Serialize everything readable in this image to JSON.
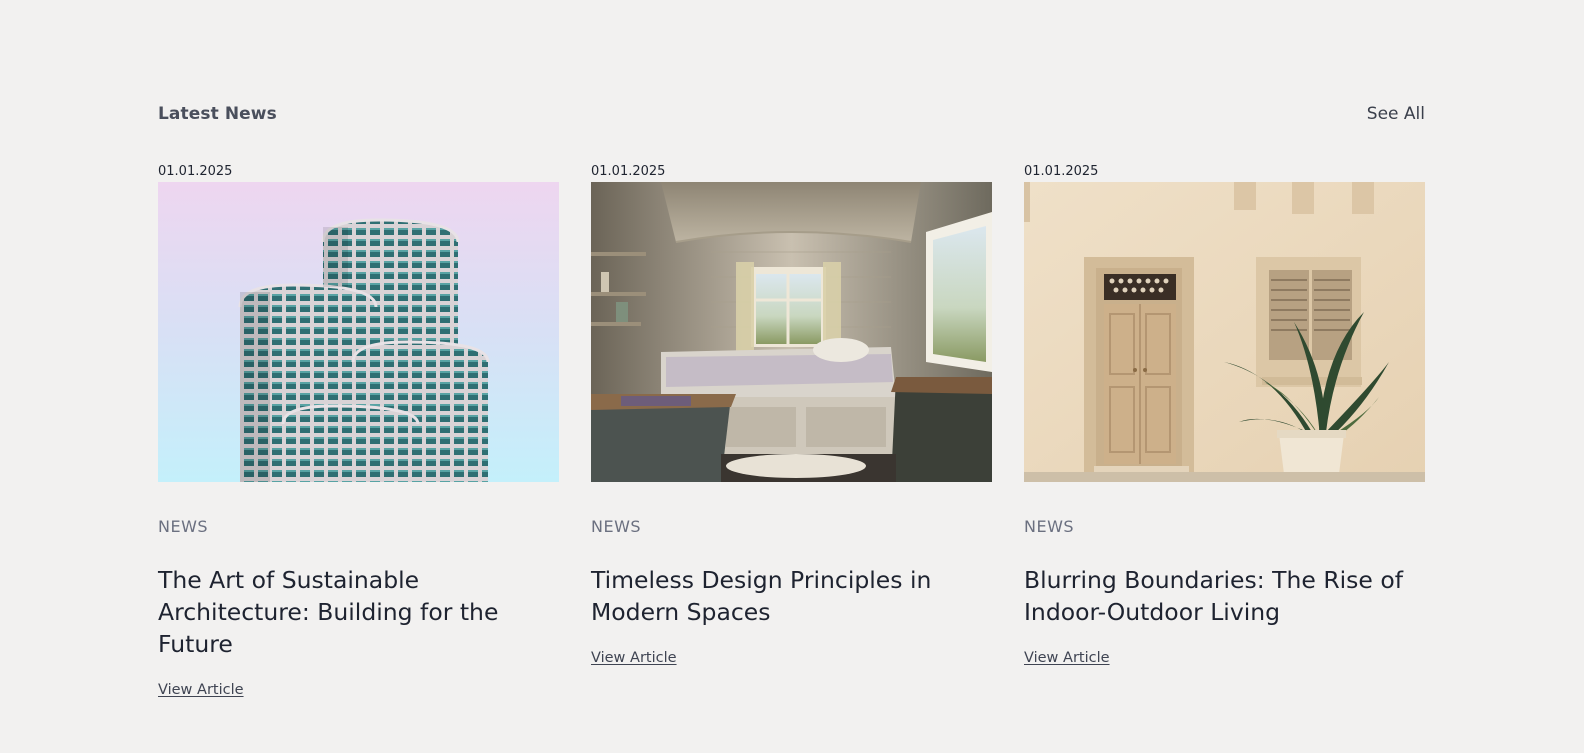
{
  "section": {
    "title": "Latest News",
    "see_all_label": "See All"
  },
  "articles": [
    {
      "date": "01.01.2025",
      "category": "NEWS",
      "title": "The Art of Sustainable Architecture: Building for the Future",
      "link_label": "View Article"
    },
    {
      "date": "01.01.2025",
      "category": "NEWS",
      "title": "Timeless Design Principles in Modern Spaces",
      "link_label": "View Article"
    },
    {
      "date": "01.01.2025",
      "category": "NEWS",
      "title": "Blurring Boundaries: The Rise of Indoor-Outdoor Living",
      "link_label": "View Article"
    }
  ]
}
